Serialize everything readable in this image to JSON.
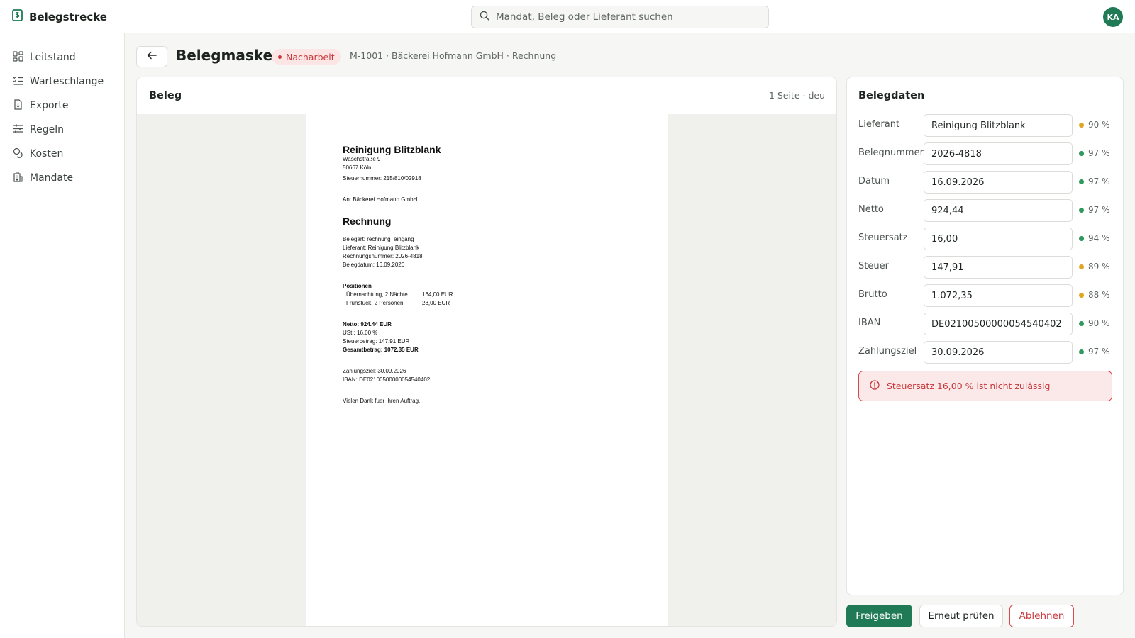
{
  "app": {
    "name": "Belegstrecke",
    "user_initials": "KA"
  },
  "search": {
    "placeholder": "Mandat, Beleg oder Lieferant suchen"
  },
  "sidebar": {
    "items": [
      {
        "label": "Leitstand",
        "icon": "dashboard-icon"
      },
      {
        "label": "Warteschlange",
        "icon": "list-check-icon"
      },
      {
        "label": "Exporte",
        "icon": "file-download-icon"
      },
      {
        "label": "Regeln",
        "icon": "sliders-icon"
      },
      {
        "label": "Kosten",
        "icon": "coins-icon"
      },
      {
        "label": "Mandate",
        "icon": "building-icon"
      }
    ]
  },
  "header": {
    "title": "Belegmaske",
    "status": "Nacharbeit",
    "breadcrumb": "M-1001 · Bäckerei Hofmann GmbH · Rechnung"
  },
  "document": {
    "panel_title": "Beleg",
    "meta": "1 Seite · deu",
    "supplier": "Reinigung Blitzblank",
    "street": "Waschstraße 9",
    "city": "50667 Köln",
    "tax_number": "Steuernummer: 215/810/02918",
    "recipient": "An: Bäckerei Hofmann GmbH",
    "heading": "Rechnung",
    "belegart": "Belegart: rechnung_eingang",
    "lieferant": "Lieferant: Reinigung Blitzblank",
    "rechnungsnummer": "Rechnungsnummer: 2026-4818",
    "belegdatum": "Belegdatum: 16.09.2026",
    "positions_heading": "Positionen",
    "positions": [
      {
        "name": "Übernachtung, 2 Nächte",
        "amount": "164,00 EUR"
      },
      {
        "name": "Frühstück, 2 Personen",
        "amount": "28,00 EUR"
      }
    ],
    "netto": "Netto: 924.44 EUR",
    "ust": "USt.: 16.00 %",
    "steuerbetrag": "Steuerbetrag: 147.91 EUR",
    "gesamtbetrag": "Gesamtbetrag: 1072.35 EUR",
    "zahlungsziel": "Zahlungsziel: 30.09.2026",
    "iban": "IBAN: DE02100500000054540402",
    "closing": "Vielen Dank fuer Ihren Auftrag."
  },
  "belegdaten": {
    "title": "Belegdaten",
    "fields": [
      {
        "label": "Lieferant",
        "value": "Reinigung Blitzblank",
        "confidence": "90 %",
        "color": "#e0a521"
      },
      {
        "label": "Belegnummer",
        "value": "2026-4818",
        "confidence": "97 %",
        "color": "#2f9a5f"
      },
      {
        "label": "Datum",
        "value": "16.09.2026",
        "confidence": "97 %",
        "color": "#2f9a5f"
      },
      {
        "label": "Netto",
        "value": "924,44",
        "confidence": "97 %",
        "color": "#2f9a5f"
      },
      {
        "label": "Steuersatz",
        "value": "16,00",
        "confidence": "94 %",
        "color": "#2f9a5f"
      },
      {
        "label": "Steuer",
        "value": "147,91",
        "confidence": "89 %",
        "color": "#e0a521"
      },
      {
        "label": "Brutto",
        "value": "1.072,35",
        "confidence": "88 %",
        "color": "#e0a521"
      },
      {
        "label": "IBAN",
        "value": "DE02100500000054540402",
        "confidence": "90 %",
        "color": "#2f9a5f"
      },
      {
        "label": "Zahlungsziel",
        "value": "30.09.2026",
        "confidence": "97 %",
        "color": "#2f9a5f"
      }
    ],
    "error": "Steuersatz 16,00 % ist nicht zulässig"
  },
  "actions": {
    "approve": "Freigeben",
    "recheck": "Erneut prüfen",
    "reject": "Ablehnen"
  },
  "colors": {
    "accent": "#1f7a55",
    "danger": "#c8373b",
    "warning": "#e0a521",
    "success": "#2f9a5f"
  }
}
